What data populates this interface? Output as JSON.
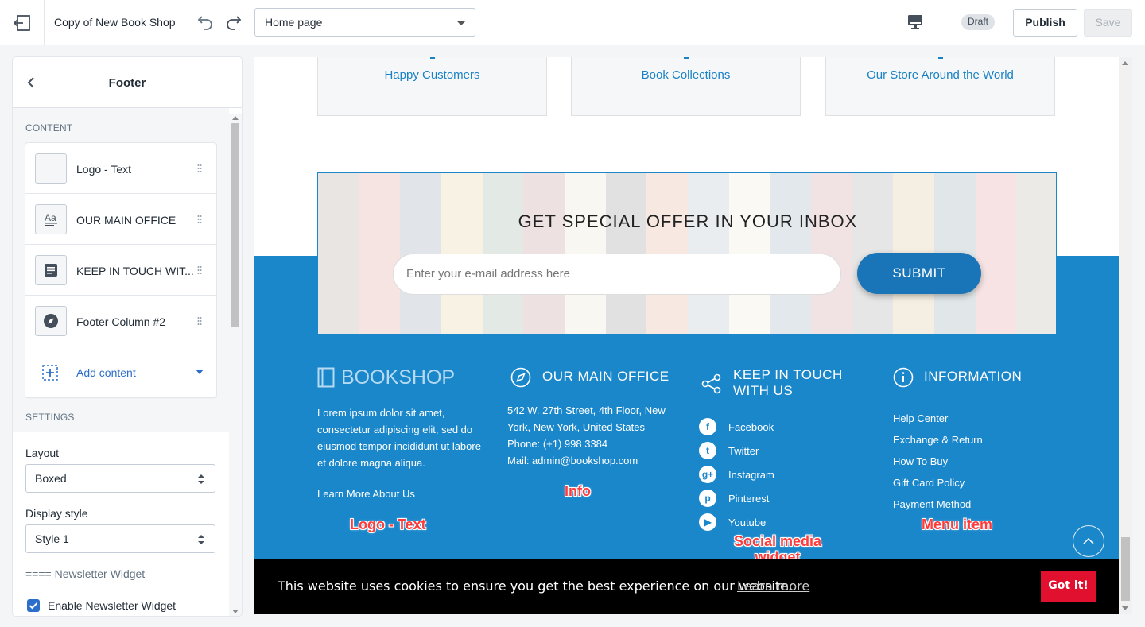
{
  "topbar": {
    "title": "Copy of New Book Shop",
    "page_select": "Home page",
    "draft_badge": "Draft",
    "publish_label": "Publish",
    "save_label": "Save"
  },
  "sidebar": {
    "title": "Footer",
    "content_section": "CONTENT",
    "items": [
      {
        "label": "Logo - Text",
        "icon": "blank-icon"
      },
      {
        "label": "OUR MAIN OFFICE",
        "icon": "text-format-icon"
      },
      {
        "label": "KEEP IN TOUCH WIT...",
        "icon": "document-icon"
      },
      {
        "label": "Footer Column #2",
        "icon": "compass-icon"
      }
    ],
    "add_content": "Add content",
    "settings_section": "SETTINGS",
    "layout_label": "Layout",
    "layout_value": "Boxed",
    "display_style_label": "Display style",
    "display_style_value": "Style 1",
    "newsletter_widget_label": "==== Newsletter Widget",
    "enable_newsletter_label": "Enable Newsletter Widget",
    "enable_newsletter_checked": true
  },
  "preview": {
    "stats": [
      {
        "label": "Happy Customers"
      },
      {
        "label": "Book Collections"
      },
      {
        "label": "Our Store Around the World"
      }
    ],
    "newsletter": {
      "heading": "GET SPECIAL OFFER IN YOUR INBOX",
      "email_placeholder": "Enter your e-mail address here",
      "submit_label": "SUBMIT"
    },
    "footer": {
      "logo_text": "BOOKSHOP",
      "about_text": "Lorem ipsum dolor sit amet, consectetur adipiscing elit, sed do eiusmod tempor incididunt ut labore et dolore magna aliqua.",
      "learn_more": "Learn More About Us",
      "office_heading": "OUR MAIN OFFICE",
      "office_lines": [
        "542 W. 27th Street, 4th Floor, New York, New York, United States",
        "Phone: (+1) 998 3384",
        "Mail: admin@bookshop.com"
      ],
      "touch_heading_1": "KEEP IN TOUCH",
      "touch_heading_2": "WITH US",
      "social": [
        {
          "name": "Facebook",
          "icon": "facebook-icon",
          "glyph": "f"
        },
        {
          "name": "Twitter",
          "icon": "twitter-icon",
          "glyph": "t"
        },
        {
          "name": "Instagram",
          "icon": "google-plus-icon",
          "glyph": "g+"
        },
        {
          "name": "Pinterest",
          "icon": "pinterest-icon",
          "glyph": "p"
        },
        {
          "name": "Youtube",
          "icon": "youtube-icon",
          "glyph": "▶"
        }
      ],
      "info_heading": "INFORMATION",
      "menu": [
        "Help Center",
        "Exchange & Return",
        "How To Buy",
        "Gift Card Policy",
        "Payment Method"
      ]
    },
    "annotations": {
      "logo_text": "Logo - Text",
      "info": "Info",
      "social_1": "Social media",
      "social_2": "widget",
      "menu_item": "Menu item"
    },
    "cookie": {
      "message": "This website uses cookies to ensure you get the best experience on our website.",
      "learn_more": "Learn more",
      "button": "Got it!"
    }
  },
  "colors": {
    "footer_blue": "#1a87cb",
    "submit_blue": "#1a75b8",
    "cookie_button": "#e0102e",
    "link_blue": "#2c6ecb"
  }
}
